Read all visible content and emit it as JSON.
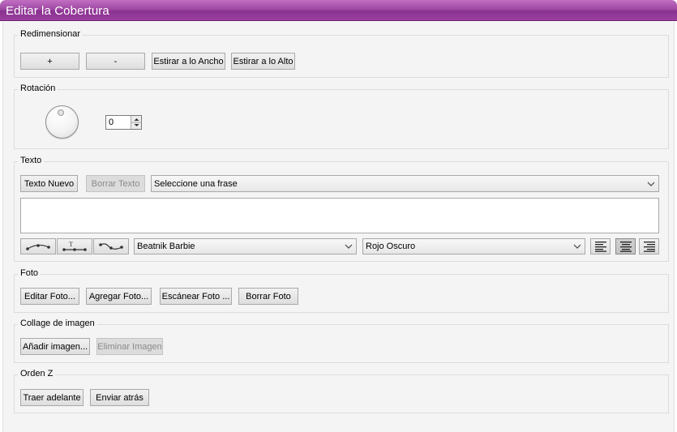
{
  "window": {
    "title": "Editar la Cobertura"
  },
  "resize": {
    "legend": "Redimensionar",
    "plus_label": "+",
    "minus_label": "-",
    "fit_width_label": "Estirar a lo Ancho",
    "fit_height_label": "Estirar a lo Alto"
  },
  "rotation": {
    "legend": "Rotación",
    "value": "0"
  },
  "text": {
    "legend": "Texto",
    "new_label": "Texto Nuevo",
    "delete_label": "Borrar Texto",
    "phrase_select": "Seleccione una frase",
    "font_select": "Beatnik Barbie",
    "color_select": "Rojo Oscuro",
    "path_icons": [
      "arc-path-icon",
      "straight-path-icon",
      "wave-path-icon"
    ],
    "align_icons": [
      "align-left-icon",
      "align-center-icon",
      "align-right-icon"
    ],
    "active_alignment": "center"
  },
  "photo": {
    "legend": "Foto",
    "edit_label": "Editar Foto...",
    "add_label": "Agregar Foto...",
    "scan_label": "Escánear Foto ...",
    "delete_label": "Borrar Foto"
  },
  "collage": {
    "legend": "Collage de imagen",
    "add_label": "Añadir imagen...",
    "remove_label": "Eliminar Imagen"
  },
  "zorder": {
    "legend": "Orden Z",
    "front_label": "Traer adelante",
    "back_label": "Enviar atrás"
  },
  "colors": {
    "titlebar": "#9b3fa0",
    "panel": "#f4f4f4"
  }
}
